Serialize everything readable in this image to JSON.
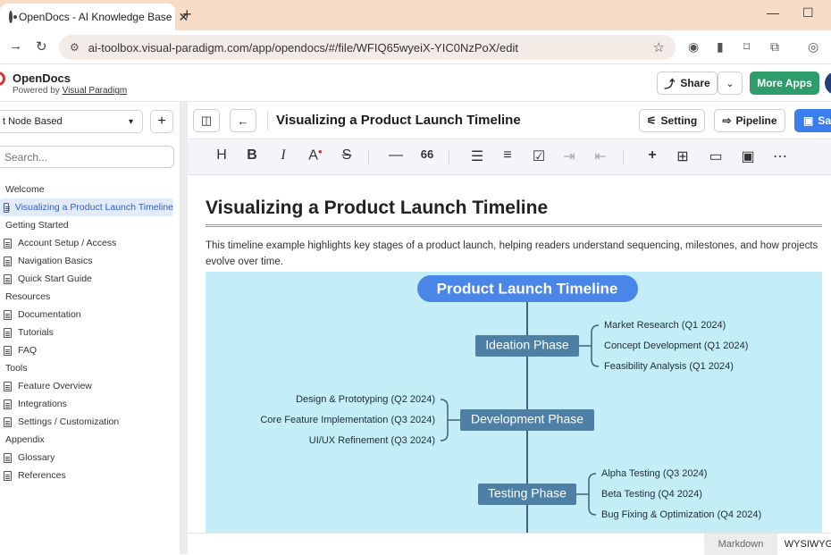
{
  "browser": {
    "tab_title": "OpenDocs - AI Knowledge Base",
    "url": "ai-toolbox.visual-paradigm.com/app/opendocs/#/file/WFIQ65wyeiX-YIC0NzPoX/edit"
  },
  "header": {
    "brand": "OpenDocs",
    "powered_prefix": "Powered by",
    "powered_link": "Visual Paradigm",
    "share_label": "Share",
    "more_apps_label": "More Apps"
  },
  "sidebar": {
    "selector_value": "t Node Based",
    "search_placeholder": "Search...",
    "tree": [
      {
        "type": "section",
        "label": "Welcome"
      },
      {
        "type": "doc",
        "label": "Visualizing a Product Launch Timeline",
        "active": true
      },
      {
        "type": "section",
        "label": "Getting Started"
      },
      {
        "type": "doc",
        "label": "Account Setup / Access"
      },
      {
        "type": "doc",
        "label": "Navigation Basics"
      },
      {
        "type": "doc",
        "label": "Quick Start Guide"
      },
      {
        "type": "section",
        "label": "Resources"
      },
      {
        "type": "doc",
        "label": "Documentation"
      },
      {
        "type": "doc",
        "label": "Tutorials"
      },
      {
        "type": "doc",
        "label": "FAQ"
      },
      {
        "type": "section",
        "label": "Tools"
      },
      {
        "type": "doc",
        "label": "Feature Overview"
      },
      {
        "type": "doc",
        "label": "Integrations"
      },
      {
        "type": "doc",
        "label": "Settings / Customization"
      },
      {
        "type": "section",
        "label": "Appendix"
      },
      {
        "type": "doc",
        "label": "Glossary"
      },
      {
        "type": "doc",
        "label": "References"
      }
    ]
  },
  "doc_toolbar": {
    "title": "Visualizing a Product Launch Timeline",
    "setting_label": "Setting",
    "pipeline_label": "Pipeline",
    "save_label": "Sav"
  },
  "content": {
    "heading": "Visualizing a Product Launch Timeline",
    "paragraph": "This timeline example highlights key stages of a product launch, helping readers understand sequencing, milestones, and how projects evolve over time."
  },
  "mindmap": {
    "root": "Product Launch Timeline",
    "phases": [
      {
        "label": "Ideation Phase",
        "side": "right",
        "items": [
          "Market Research (Q1 2024)",
          "Concept Development (Q1 2024)",
          "Feasibility Analysis (Q1 2024)"
        ]
      },
      {
        "label": "Development Phase",
        "side": "left",
        "items": [
          "Design & Prototyping (Q2 2024)",
          "Core Feature Implementation (Q3 2024)",
          "UI/UX Refinement (Q3 2024)"
        ]
      },
      {
        "label": "Testing Phase",
        "side": "right",
        "items": [
          "Alpha Testing (Q3 2024)",
          "Beta Testing (Q4 2024)",
          "Bug Fixing & Optimization (Q4 2024)"
        ]
      }
    ],
    "colors": {
      "background": "#c3eef8",
      "root": "#4a86e8",
      "phase": "#4e7fa5",
      "line": "#3f5f7a"
    }
  },
  "status_bar": {
    "markdown_label": "Markdown",
    "wysiwyg_label": "WYSIWYG"
  }
}
